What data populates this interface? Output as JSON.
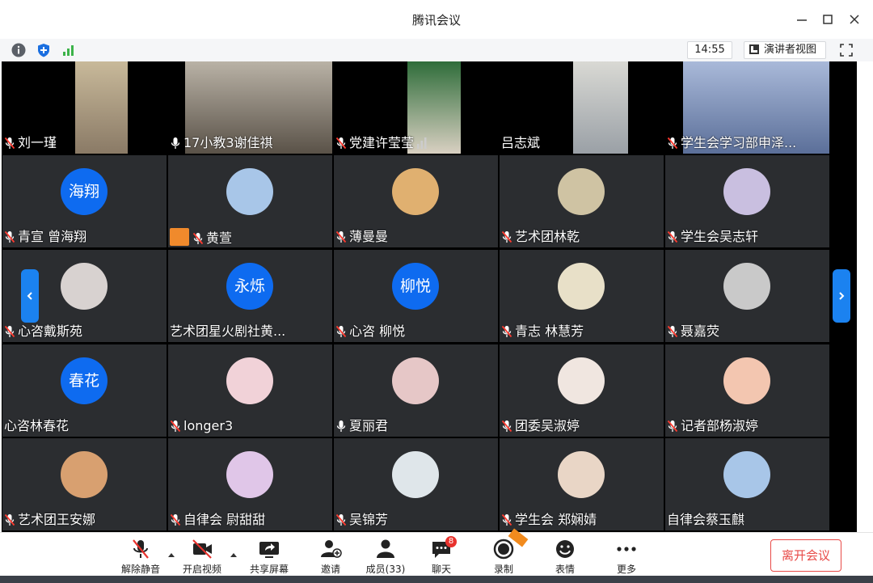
{
  "window": {
    "title": "腾讯会议"
  },
  "infobar": {
    "clock": "14:55",
    "view_label": "演讲者视图"
  },
  "participants": [
    {
      "name": "刘一瑾",
      "type": "video",
      "mic": "muted"
    },
    {
      "name": "17小教3谢佳祺",
      "type": "video",
      "mic": "on"
    },
    {
      "name": "党建许莹莹",
      "type": "video",
      "mic": "muted",
      "signal": true
    },
    {
      "name": "吕志斌",
      "type": "video",
      "mic": "none"
    },
    {
      "name": "学生会学习部申泽...",
      "type": "video",
      "mic": "muted"
    },
    {
      "name": "青宣 曾海翔",
      "type": "text",
      "avatar_text": "海翔",
      "mic": "muted"
    },
    {
      "name": "黄萱",
      "type": "image",
      "mic": "muted",
      "host": true
    },
    {
      "name": "薄曼曼",
      "type": "image",
      "mic": "muted"
    },
    {
      "name": "艺术团林乾",
      "type": "image",
      "mic": "muted"
    },
    {
      "name": "学生会吴志轩",
      "type": "image",
      "mic": "muted"
    },
    {
      "name": "心咨戴斯苑",
      "type": "image",
      "mic": "muted"
    },
    {
      "name": "艺术团星火剧社黄...",
      "type": "text",
      "avatar_text": "永烁",
      "mic": "none"
    },
    {
      "name": "心咨 柳悦",
      "type": "text",
      "avatar_text": "柳悦",
      "mic": "muted"
    },
    {
      "name": "青志 林慧芳",
      "type": "image",
      "mic": "muted"
    },
    {
      "name": "聂嘉荧",
      "type": "image",
      "mic": "muted"
    },
    {
      "name": "心咨林春花",
      "type": "text",
      "avatar_text": "春花",
      "mic": "none"
    },
    {
      "name": "longer3",
      "type": "image",
      "mic": "muted"
    },
    {
      "name": "夏丽君",
      "type": "image",
      "mic": "on"
    },
    {
      "name": "团委吴淑婷",
      "type": "image",
      "mic": "muted"
    },
    {
      "name": "记者部杨淑婷",
      "type": "image",
      "mic": "muted"
    },
    {
      "name": "艺术团王安娜",
      "type": "image",
      "mic": "muted"
    },
    {
      "name": "自律会 尉甜甜",
      "type": "image",
      "mic": "muted"
    },
    {
      "name": "吴锦芳",
      "type": "image",
      "mic": "muted"
    },
    {
      "name": "学生会 郑娴婧",
      "type": "image",
      "mic": "muted"
    },
    {
      "name": "自律会蔡玉麒",
      "type": "image",
      "mic": "none"
    }
  ],
  "toolbar": {
    "mute": "解除静音",
    "video": "开启视频",
    "share": "共享屏幕",
    "invite": "邀请",
    "members": "成员(33)",
    "chat": "聊天",
    "chat_badge": "8",
    "record": "录制",
    "reactions": "表情",
    "more": "更多",
    "leave": "离开会议"
  },
  "colors": {
    "accent": "#0e6bf0",
    "leave": "#e84a47",
    "tile": "#2b2d30"
  }
}
